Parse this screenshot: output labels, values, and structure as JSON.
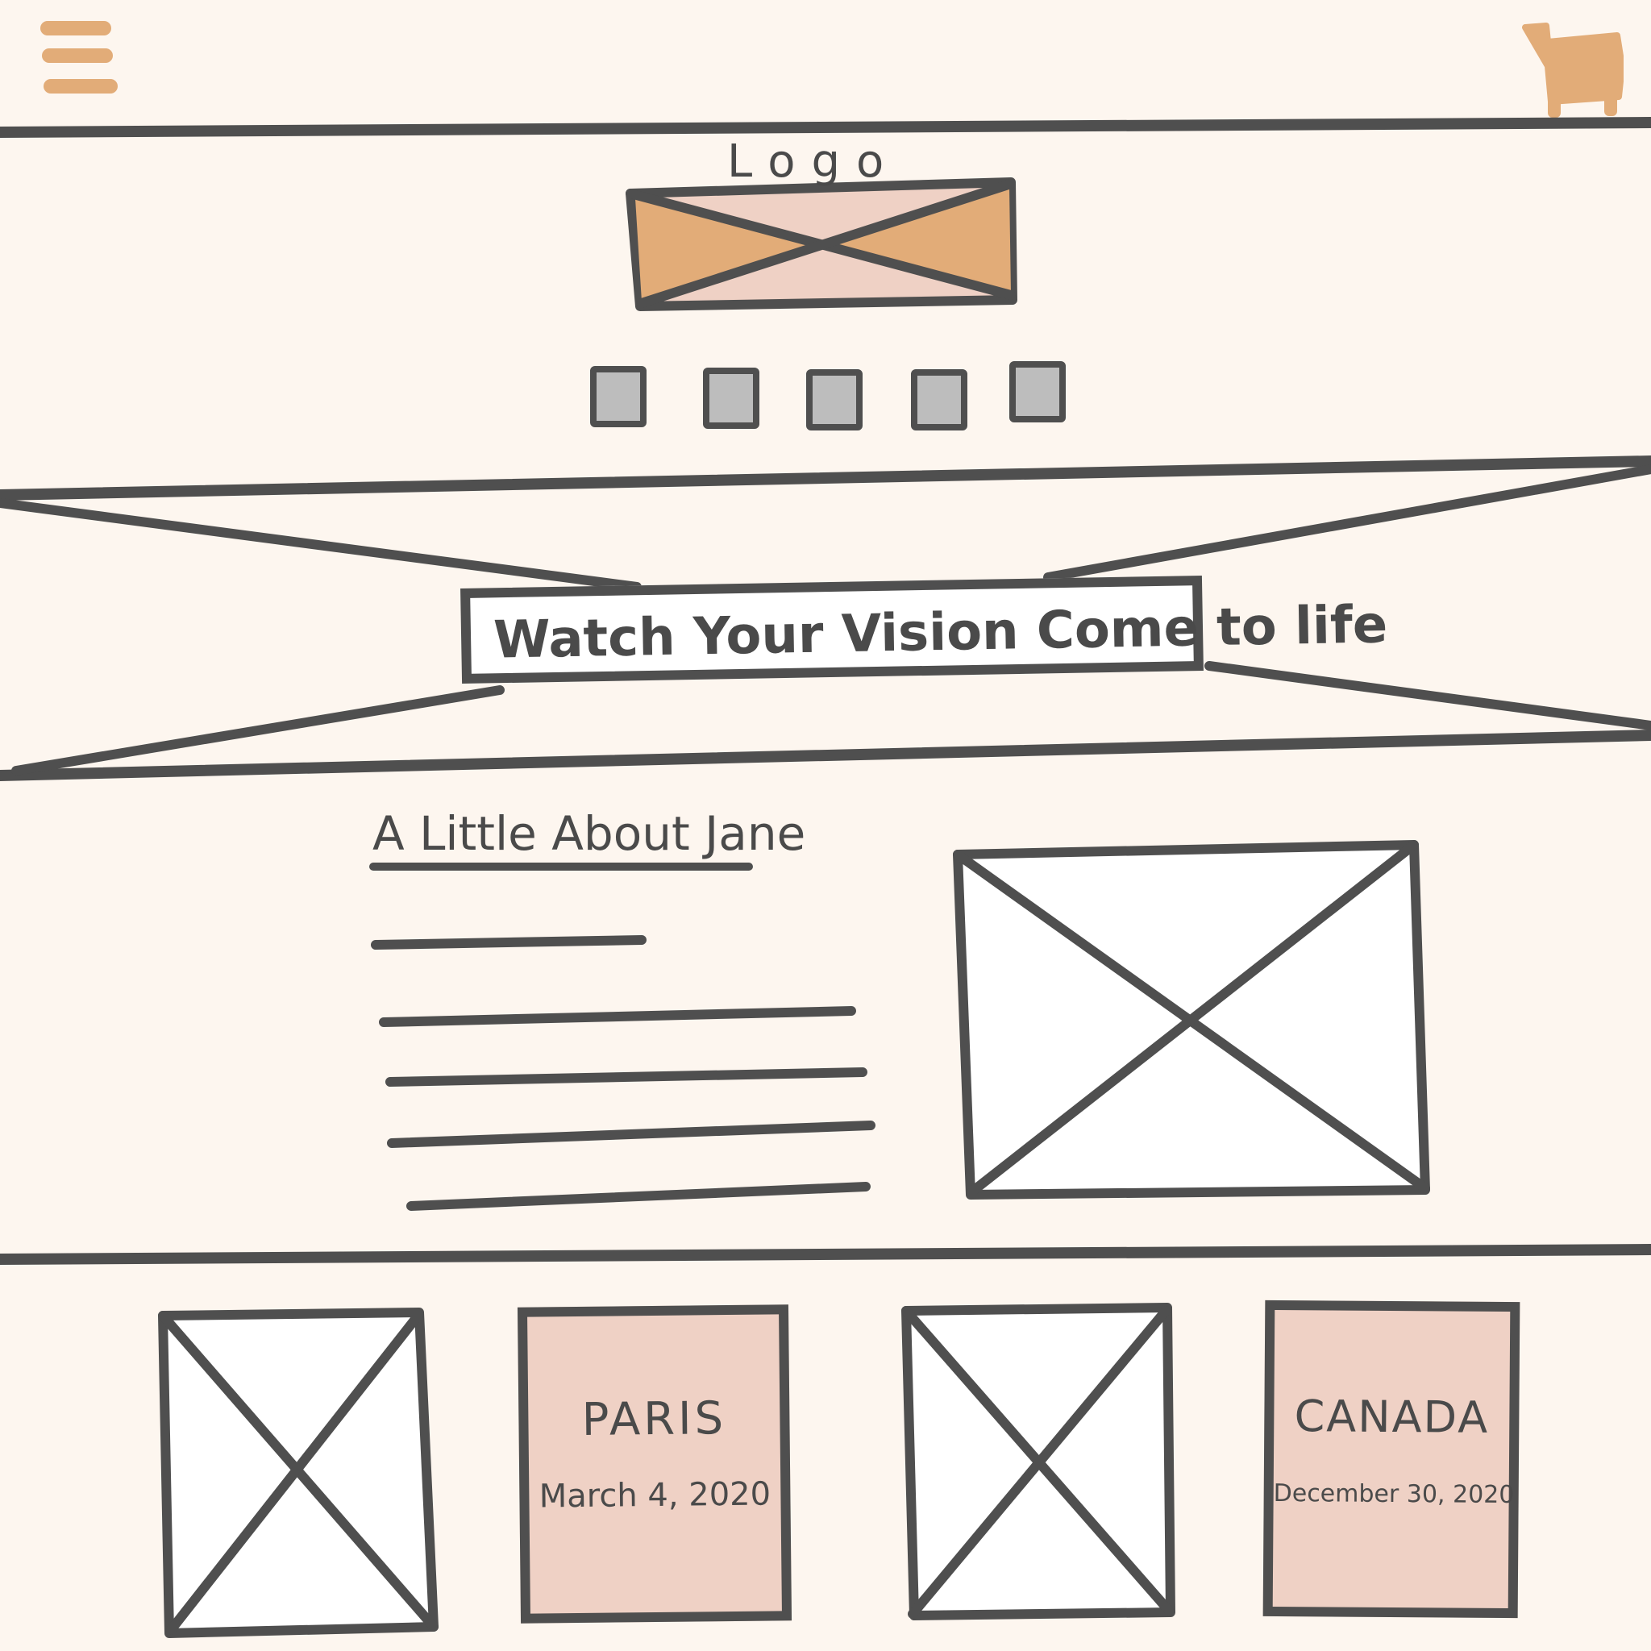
{
  "header": {
    "menu_icon": "hamburger-menu-icon",
    "cart_icon": "shopping-cart-icon"
  },
  "branding": {
    "logo_label": "Logo",
    "nav_item_count": 5
  },
  "hero": {
    "tagline": "Watch Your Vision Come to life"
  },
  "about": {
    "heading": "A Little About Jane"
  },
  "cards": [
    {
      "type": "image"
    },
    {
      "type": "text",
      "title": "PARIS",
      "date": "March 4, 2020"
    },
    {
      "type": "image"
    },
    {
      "type": "text",
      "title": "CANADA",
      "date": "December 30, 2020"
    }
  ],
  "colors": {
    "background": "#fdf6ef",
    "stroke": "#4f4f4f",
    "accent_orange": "#e2ac78",
    "accent_pink": "#efd1c5",
    "nav_gray": "#bdbdbd"
  }
}
